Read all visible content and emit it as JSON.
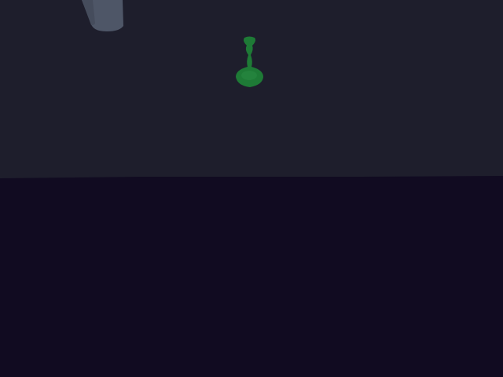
{
  "scene": {
    "colors": {
      "wall": "#1e1e2c",
      "floor": "#110b21",
      "hanging_object": "#4e5667",
      "hanging_object_shade": "#454c5c",
      "vase": "#1e7a36",
      "vase_highlight": "#2a8c43"
    },
    "objects": [
      "wall",
      "floor",
      "ceiling-lamp",
      "vase-icon"
    ]
  }
}
